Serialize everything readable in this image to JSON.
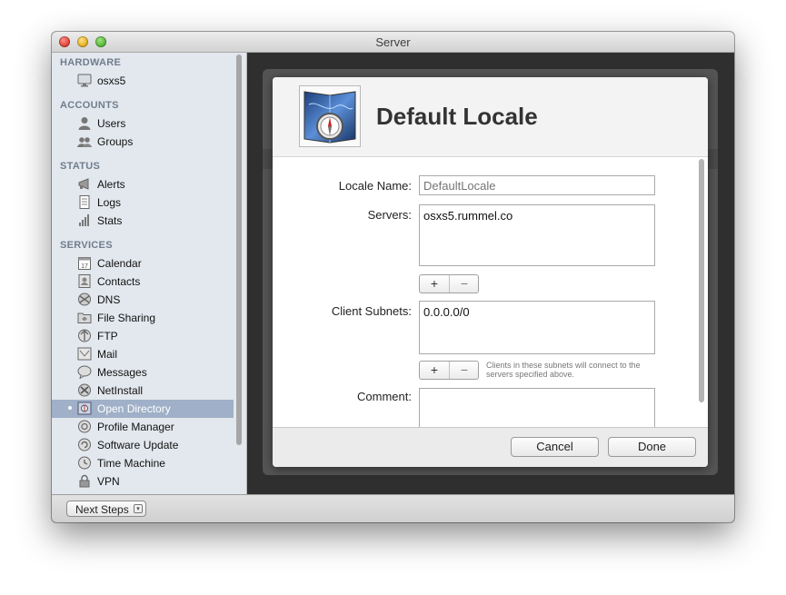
{
  "window": {
    "title": "Server"
  },
  "sidebar": {
    "sections": [
      {
        "heading": "HARDWARE",
        "items": [
          {
            "label": "osxs5",
            "icon": "computer-icon"
          }
        ]
      },
      {
        "heading": "ACCOUNTS",
        "items": [
          {
            "label": "Users",
            "icon": "user-icon"
          },
          {
            "label": "Groups",
            "icon": "group-icon"
          }
        ]
      },
      {
        "heading": "STATUS",
        "items": [
          {
            "label": "Alerts",
            "icon": "megaphone-icon"
          },
          {
            "label": "Logs",
            "icon": "document-icon"
          },
          {
            "label": "Stats",
            "icon": "bar-chart-icon"
          }
        ]
      },
      {
        "heading": "SERVICES",
        "items": [
          {
            "label": "Calendar",
            "icon": "calendar-icon"
          },
          {
            "label": "Contacts",
            "icon": "contacts-icon"
          },
          {
            "label": "DNS",
            "icon": "dns-icon"
          },
          {
            "label": "File Sharing",
            "icon": "folder-icon"
          },
          {
            "label": "FTP",
            "icon": "ftp-icon"
          },
          {
            "label": "Mail",
            "icon": "mail-icon"
          },
          {
            "label": "Messages",
            "icon": "messages-icon"
          },
          {
            "label": "NetInstall",
            "icon": "netinstall-icon"
          },
          {
            "label": "Open Directory",
            "icon": "open-directory-icon",
            "selected": true
          },
          {
            "label": "Profile Manager",
            "icon": "profile-manager-icon"
          },
          {
            "label": "Software Update",
            "icon": "software-update-icon"
          },
          {
            "label": "Time Machine",
            "icon": "time-machine-icon"
          },
          {
            "label": "VPN",
            "icon": "lock-icon"
          }
        ]
      }
    ]
  },
  "bottombar": {
    "next_steps_label": "Next Steps"
  },
  "sheet": {
    "title": "Default Locale",
    "icon": "compass-icon",
    "form": {
      "locale_name_label": "Locale Name:",
      "locale_name_placeholder": "DefaultLocale",
      "servers_label": "Servers:",
      "servers_value": "osxs5.rummel.co",
      "client_subnets_label": "Client Subnets:",
      "client_subnets_value": "0.0.0.0/0",
      "subnets_hint": "Clients in these subnets will connect to the servers specified above.",
      "comment_label": "Comment:",
      "comment_value": "",
      "plus_glyph": "+",
      "minus_glyph": "−"
    },
    "buttons": {
      "cancel": "Cancel",
      "done": "Done"
    }
  }
}
